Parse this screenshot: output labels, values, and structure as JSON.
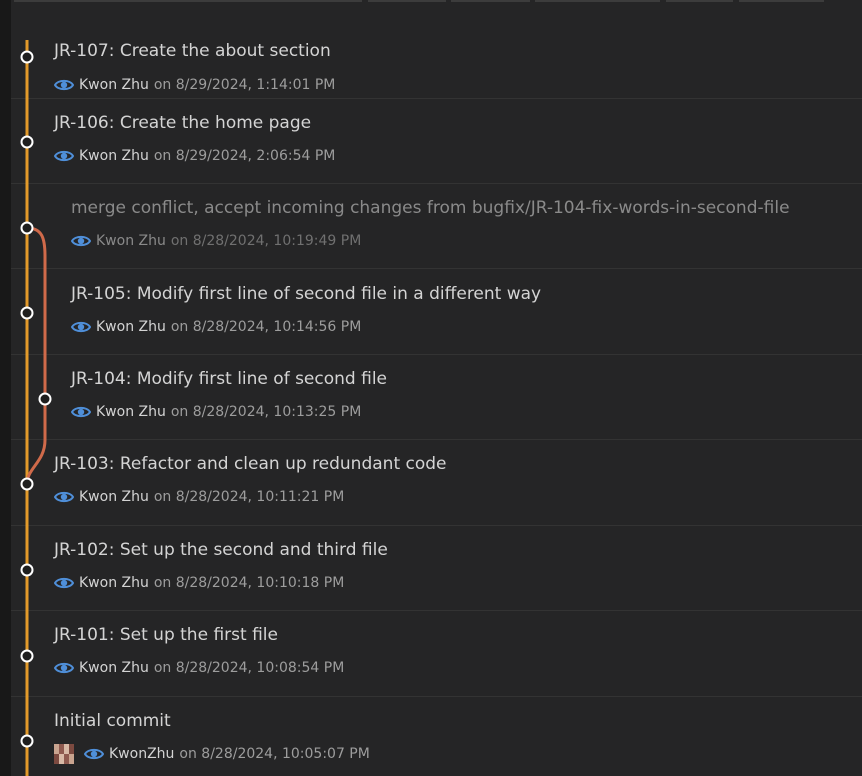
{
  "colors": {
    "background": "#252526",
    "main_branch": "#e39a2a",
    "side_branch": "#d06a4a",
    "eye_icon": "#4f8fd9"
  },
  "commits": [
    {
      "title": "JR-107: Create the about section",
      "author": "Kwon Zhu",
      "date": "on 8/29/2024, 1:14:01 PM",
      "icon": "eye-icon"
    },
    {
      "title": "JR-106: Create the home page",
      "author": "Kwon Zhu",
      "date": "on 8/29/2024, 2:06:54 PM",
      "icon": "eye-icon"
    },
    {
      "title": "merge conflict, accept incoming changes from bugfix/JR-104-fix-words-in-second-file",
      "author": "Kwon Zhu",
      "date": "on 8/28/2024, 10:19:49 PM",
      "icon": "eye-icon"
    },
    {
      "title": "JR-105: Modify first line of second file in a different way",
      "author": "Kwon Zhu",
      "date": "on 8/28/2024, 10:14:56 PM",
      "icon": "eye-icon"
    },
    {
      "title": "JR-104: Modify first line of second file",
      "author": "Kwon Zhu",
      "date": "on 8/28/2024, 10:13:25 PM",
      "icon": "eye-icon"
    },
    {
      "title": "JR-103: Refactor and clean up redundant code",
      "author": "Kwon Zhu",
      "date": "on 8/28/2024, 10:11:21 PM",
      "icon": "eye-icon"
    },
    {
      "title": "JR-102: Set up the second and third file",
      "author": "Kwon Zhu",
      "date": "on 8/28/2024, 10:10:18 PM",
      "icon": "eye-icon"
    },
    {
      "title": "JR-101: Set up the first file",
      "author": "Kwon Zhu",
      "date": "on 8/28/2024, 10:08:54 PM",
      "icon": "eye-icon"
    },
    {
      "title": "Initial commit",
      "author": "KwonZhu",
      "date": "on 8/28/2024, 10:05:07 PM",
      "icon": "eye-icon"
    }
  ]
}
